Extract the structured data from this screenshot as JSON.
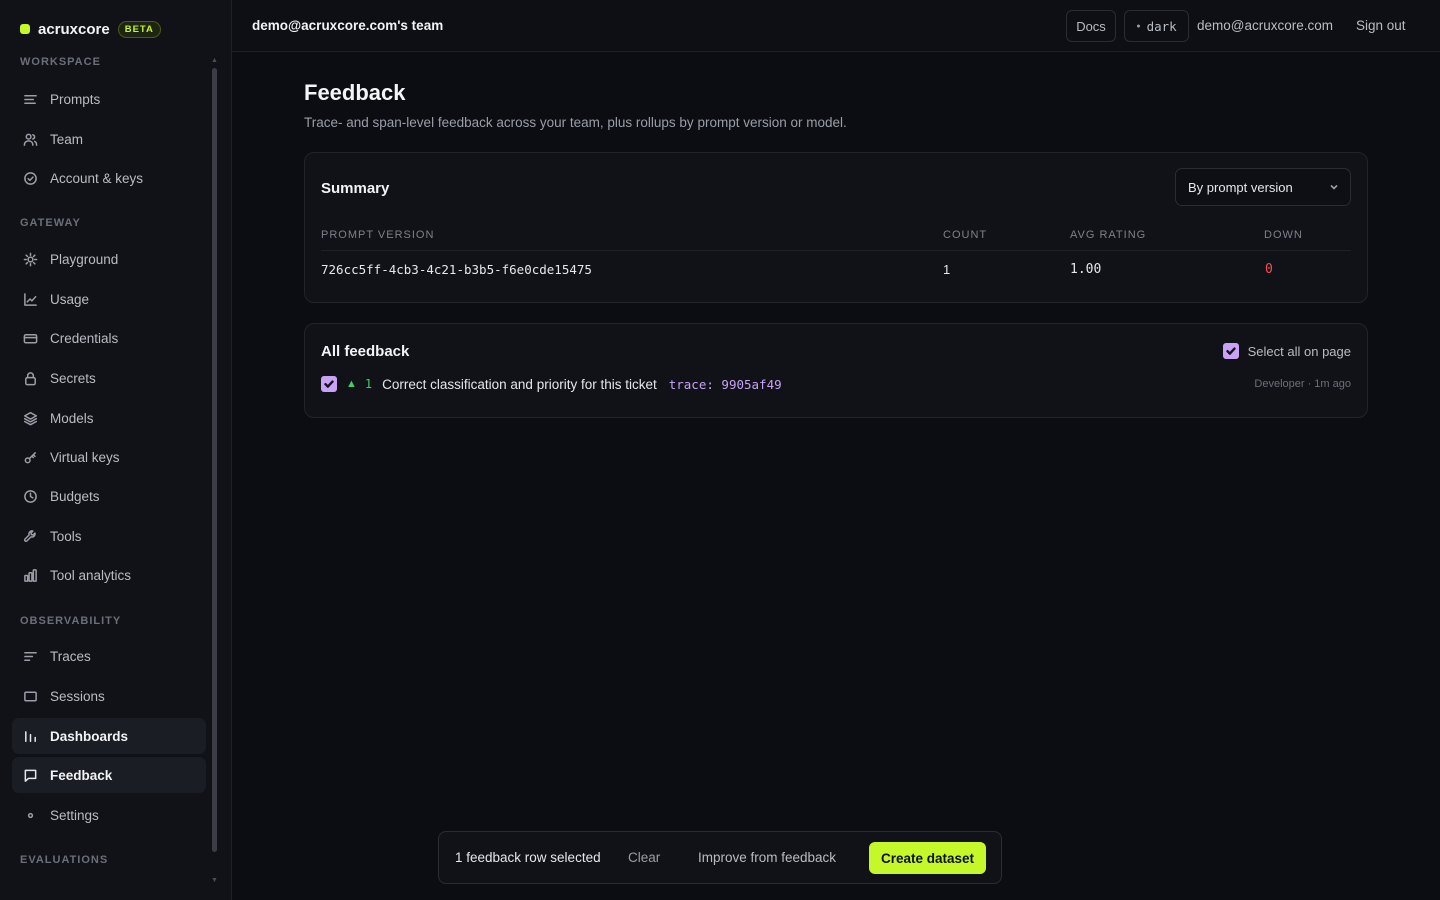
{
  "app": {
    "brand_name": "acruxcore",
    "brand_badge": "BETA",
    "accent_color": "#c5f82a"
  },
  "sidebar": {
    "sections": [
      {
        "label": "WORKSPACE"
      },
      {
        "label": "GATEWAY"
      },
      {
        "label": "OBSERVABILITY"
      },
      {
        "label": "EVALUATIONS"
      }
    ],
    "items": [
      {
        "label": "Prompts",
        "icon": "list-icon"
      },
      {
        "label": "Team",
        "icon": "users-icon"
      },
      {
        "label": "Account & keys",
        "icon": "check-circle-icon"
      },
      {
        "label": "Playground",
        "icon": "sun-icon"
      },
      {
        "label": "Usage",
        "icon": "line-chart-icon"
      },
      {
        "label": "Credentials",
        "icon": "card-icon"
      },
      {
        "label": "Secrets",
        "icon": "lock-icon"
      },
      {
        "label": "Models",
        "icon": "layers-icon"
      },
      {
        "label": "Virtual keys",
        "icon": "key-icon"
      },
      {
        "label": "Budgets",
        "icon": "clock-icon"
      },
      {
        "label": "Tools",
        "icon": "wrench-icon"
      },
      {
        "label": "Tool analytics",
        "icon": "bar-chart-icon"
      },
      {
        "label": "Traces",
        "icon": "traces-icon"
      },
      {
        "label": "Sessions",
        "icon": "window-icon"
      },
      {
        "label": "Dashboards",
        "icon": "bar-chart-icon"
      },
      {
        "label": "Feedback",
        "icon": "message-icon"
      },
      {
        "label": "Settings",
        "icon": "dot-icon"
      }
    ],
    "active_items": [
      "Dashboards",
      "Feedback"
    ]
  },
  "topbar": {
    "team_name": "demo@acruxcore.com's team",
    "docs_label": "Docs",
    "theme_label": "dark",
    "user_email": "demo@acruxcore.com",
    "sign_out_label": "Sign out"
  },
  "page": {
    "title": "Feedback",
    "subtitle": "Trace- and span-level feedback across your team, plus rollups by prompt version or model."
  },
  "summary": {
    "title": "Summary",
    "group_by": "By prompt version",
    "columns": [
      "PROMPT VERSION",
      "COUNT",
      "AVG RATING",
      "DOWN"
    ],
    "rows": [
      {
        "prompt_version": "726cc5ff-4cb3-4c21-b3b5-f6e0cde15475",
        "count": "1",
        "avg_rating": "1.00",
        "down": "0"
      }
    ],
    "down_color": "#f05252"
  },
  "all_feedback": {
    "title": "All feedback",
    "select_all_label": "Select all on page",
    "select_all_checked": true,
    "items": [
      {
        "checked": true,
        "direction_icon": "▲",
        "rating": "1",
        "comment": "Correct classification and priority for this ticket",
        "trace": "trace: 9905af49",
        "meta": "Developer · 1m ago"
      }
    ]
  },
  "action_bar": {
    "selected_text": "1 feedback row selected",
    "clear_label": "Clear",
    "improve_label": "Improve from feedback",
    "create_label": "Create dataset"
  }
}
